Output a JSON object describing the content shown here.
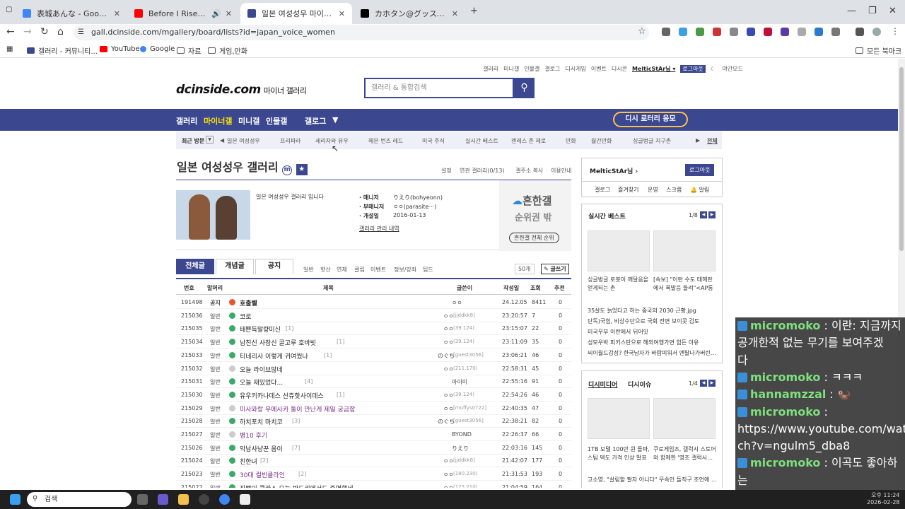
{
  "browser": {
    "tabs": [
      {
        "title": "表城あんな - Google 検索",
        "icon_color": "#4285f4",
        "active": false
      },
      {
        "title": "Before I Rise - YouTube",
        "icon_color": "#ff0000",
        "active": false
      },
      {
        "title": "일본 여성성우 마이너 갤러리",
        "icon_color": "#3b4890",
        "active": true
      },
      {
        "title": "カホタン@グッスマのすみっこ…",
        "icon_color": "#000000",
        "active": false
      }
    ],
    "new_tab": "+",
    "url": "gall.dcinside.com/mgallery/board/lists?id=japan_voice_women",
    "bookmarks": [
      "갤러리 - 커뮤니티...",
      "YouTube",
      "Google",
      "자료",
      "게임,만화"
    ],
    "all_bookmarks": "모든 북마크"
  },
  "site": {
    "top_links": [
      "갤러리",
      "미니갤",
      "인물갤",
      "갤로그",
      "디시게임",
      "이벤트",
      "디시콘",
      "MelticStAr님 ▾",
      "로그아웃",
      "야간모드"
    ],
    "logo": "dcinside.com",
    "logo_sub": "마이너 갤러리",
    "search_placeholder": "갤러리 & 통합검색",
    "gnb": [
      "갤러리",
      "마이너갤",
      "미니갤",
      "인물갤",
      "갤로그"
    ],
    "lotto": "디시 로터리 응모",
    "recent_label": "최근 방문",
    "recent": [
      "일본 여성성우",
      "프리파라",
      "세리자와 유우",
      "헤븐 번즈 레드",
      "미국 주식",
      "실시간 베스트",
      "젠레스 존 제로",
      "만화",
      "월간만화",
      "싱글벙글 지구촌"
    ],
    "recent_all": "전체"
  },
  "gallery": {
    "title": "일본 여성성우 갤러리",
    "menu": [
      "설정",
      "연관 갤러리(0/13)",
      "갤주소 복사",
      "이용안내"
    ],
    "intro": "일본 여성성우 갤러리 입니다",
    "manager_label": "· 매니저",
    "manager": "りえり(bohyeonn)",
    "submanager_label": "· 부매니저",
    "submanager": "ㅇㅇ(parasite···)",
    "opened_label": "· 개설일",
    "opened": "2016-01-13",
    "admin_link": "갤러리 관리 내역",
    "rank_title": "흔한갤",
    "rank_sub": "순위권 밖",
    "rank_btn": "흔한갤 전체 순위",
    "tabs": [
      "전체글",
      "개념글",
      "공지"
    ],
    "subtabs": [
      "일반",
      "핫산",
      "연재",
      "클립",
      "이벤트",
      "정보/강좌",
      "팁드"
    ],
    "per_page": "50개",
    "write": "글쓰기",
    "columns": [
      "번호",
      "말머리",
      "제목",
      "글쓴이",
      "작성일",
      "조회",
      "추천"
    ]
  },
  "posts": [
    {
      "no": "191498",
      "head": "공지",
      "title": "호출벨",
      "cnt": "",
      "author": "ㅇㅇ",
      "ip": "",
      "date": "24.12.05",
      "views": "8411",
      "rec": "0",
      "ic": "#e8552a",
      "bold": true
    },
    {
      "no": "215036",
      "head": "일반",
      "title": "코로",
      "cnt": "",
      "author": "ㅇㅇ",
      "ip": "[jjddkk8]",
      "date": "23:20:57",
      "views": "7",
      "rec": "0",
      "ic": "#3aaa6a"
    },
    {
      "no": "215035",
      "head": "일반",
      "title": "태쁜득말량미신",
      "cnt": "[1]",
      "author": "ㅇㅇ",
      "ip": "(39.124)",
      "date": "23:15:07",
      "views": "22",
      "rec": "0",
      "ic": "#3aaa6a"
    },
    {
      "no": "215034",
      "head": "일반",
      "title": "남친신 사장신 골고루 호바빗",
      "cnt": "[1]",
      "author": "ㅇㅇ",
      "ip": "(39.124)",
      "date": "23:11:09",
      "views": "35",
      "rec": "0",
      "ic": "#3aaa6a"
    },
    {
      "no": "215033",
      "head": "일반",
      "title": "티네리사 이렇게 귀여웠나",
      "cnt": "[1]",
      "author": "のぐち",
      "ip": "[guest3056]",
      "date": "23:06:21",
      "views": "46",
      "rec": "0",
      "ic": "#3aaa6a"
    },
    {
      "no": "215032",
      "head": "일반",
      "title": "오늘 라이브많네",
      "cnt": "",
      "author": "ㅇㅇ",
      "ip": "(211.170)",
      "date": "22:58:31",
      "views": "45",
      "rec": "0",
      "ic": "#cccccc"
    },
    {
      "no": "215031",
      "head": "일반",
      "title": "오늘 재밌었다...",
      "cnt": "[4]",
      "author": "아이미",
      "ip": "",
      "date": "22:55:16",
      "views": "91",
      "rec": "0",
      "ic": "#3aaa6a"
    },
    {
      "no": "215030",
      "head": "일반",
      "title": "유우키카나데스 산쥬핫사이데스",
      "cnt": "[1]",
      "author": "ㅇㅇ",
      "ip": "(39.124)",
      "date": "22:54:26",
      "views": "46",
      "rec": "0",
      "ic": "#3aaa6a"
    },
    {
      "no": "215029",
      "head": "일반",
      "title": "미사와랑 우에사카 둘이 만난게 제일 궁금함",
      "cnt": "",
      "author": "ㅇㅇ",
      "ip": "[muffys0722]",
      "date": "22:40:35",
      "views": "47",
      "rec": "0",
      "ic": "#cccccc",
      "purple": true
    },
    {
      "no": "215028",
      "head": "일반",
      "title": "하치포치 마치코",
      "cnt": "[3]",
      "author": "のぐち",
      "ip": "[guest3056]",
      "date": "22:38:21",
      "views": "82",
      "rec": "0",
      "ic": "#3aaa6a"
    },
    {
      "no": "215027",
      "head": "일반",
      "title": "병10 후기",
      "cnt": "",
      "author": "BYOND",
      "ip": "",
      "date": "22:26:37",
      "views": "66",
      "rec": "0",
      "ic": "#cccccc",
      "purple": true
    },
    {
      "no": "215026",
      "head": "일반",
      "title": "악남사냥꾼 옴이",
      "cnt": "[7]",
      "author": "りえり",
      "ip": "",
      "date": "22:03:16",
      "views": "145",
      "rec": "0",
      "ic": "#3aaa6a"
    },
    {
      "no": "215024",
      "head": "일반",
      "title": "친한녀",
      "cnt": "[2]",
      "author": "ㅇㅇ",
      "ip": "[jjddkk8]",
      "date": "21:42:07",
      "views": "177",
      "rec": "0",
      "ic": "#3aaa6a"
    },
    {
      "no": "215023",
      "head": "일반",
      "title": "30대 컬빈클라인",
      "cnt": "[2]",
      "author": "ㅇㅇ",
      "ip": "(180.230)",
      "date": "21:31:53",
      "views": "193",
      "rec": "0",
      "ic": "#3aaa6a",
      "purple": true
    },
    {
      "no": "215022",
      "head": "일반",
      "title": "좌빵이 클라스 오늘 반드리에서도 증명했네",
      "cnt": "",
      "author": "ㅇㅇ",
      "ip": "(125.210)",
      "date": "21:04:59",
      "views": "164",
      "rec": "0",
      "ic": "#3aaa6a"
    }
  ],
  "sidebar": {
    "user": "MelticStAr님",
    "logout": "로그아웃",
    "user_links": [
      "갤로그",
      "즐겨찾기",
      "운영",
      "스크랩",
      "알림"
    ],
    "best_title": "실시간 베스트",
    "best_page": "1/8",
    "best_captions": [
      "싱글벙글 로봇이 깨달음을 얻게되는 촌",
      "[속보] \"이란 수도 테헤란에서 폭발음 들려\"<AP통"
    ],
    "best_list": [
      "35살도 늙었다고 하는 중국의 2030 근황.jpg",
      "단독)국힘, 비상수단으로 국회 전면 보이콧 검토",
      "미국무부 이란에서 뒤어잇",
      "성모우박 피키스탄으로 해외여행가면 힘든 이유",
      "씨이월드감성? 한국남자가 바람피워서 엔탈나가버린…"
    ],
    "media_title": "디시미디어",
    "media_title2": "디시이슈",
    "media_page": "1/4",
    "media_captions": [
      "1TB 모델 100만 원 돌파, 스팀 덱도 가격 인상 발표",
      "쿠로게임즈, 갤럭시 스토어와 함께한 '명조 갤럭시…"
    ],
    "media_more": "고소영, \"살림할 팔자 아니다\" 무속인 돌직구 조언에 …"
  },
  "chat": [
    {
      "user": "micromoko",
      "msg": "이란: 지금까지"
    },
    {
      "user": "",
      "msg": "공개한적 없는 무기를 보여주겠"
    },
    {
      "user": "",
      "msg": "다"
    },
    {
      "user": "micromoko",
      "msg": "ㅋㅋㅋ"
    },
    {
      "user": "hannamzzal",
      "msg": "🦦"
    },
    {
      "user": "micromoko",
      "msg": ""
    },
    {
      "user": "",
      "msg": "https://www.youtube.com/wat"
    },
    {
      "user": "",
      "msg": "ch?v=ngulm5_dba8"
    },
    {
      "user": "micromoko",
      "msg": "이곡도 좋아하"
    },
    {
      "user": "",
      "msg": "는"
    }
  ],
  "taskbar": {
    "search": "검색",
    "time": "오후 11:24",
    "date": "2026-02-28"
  }
}
